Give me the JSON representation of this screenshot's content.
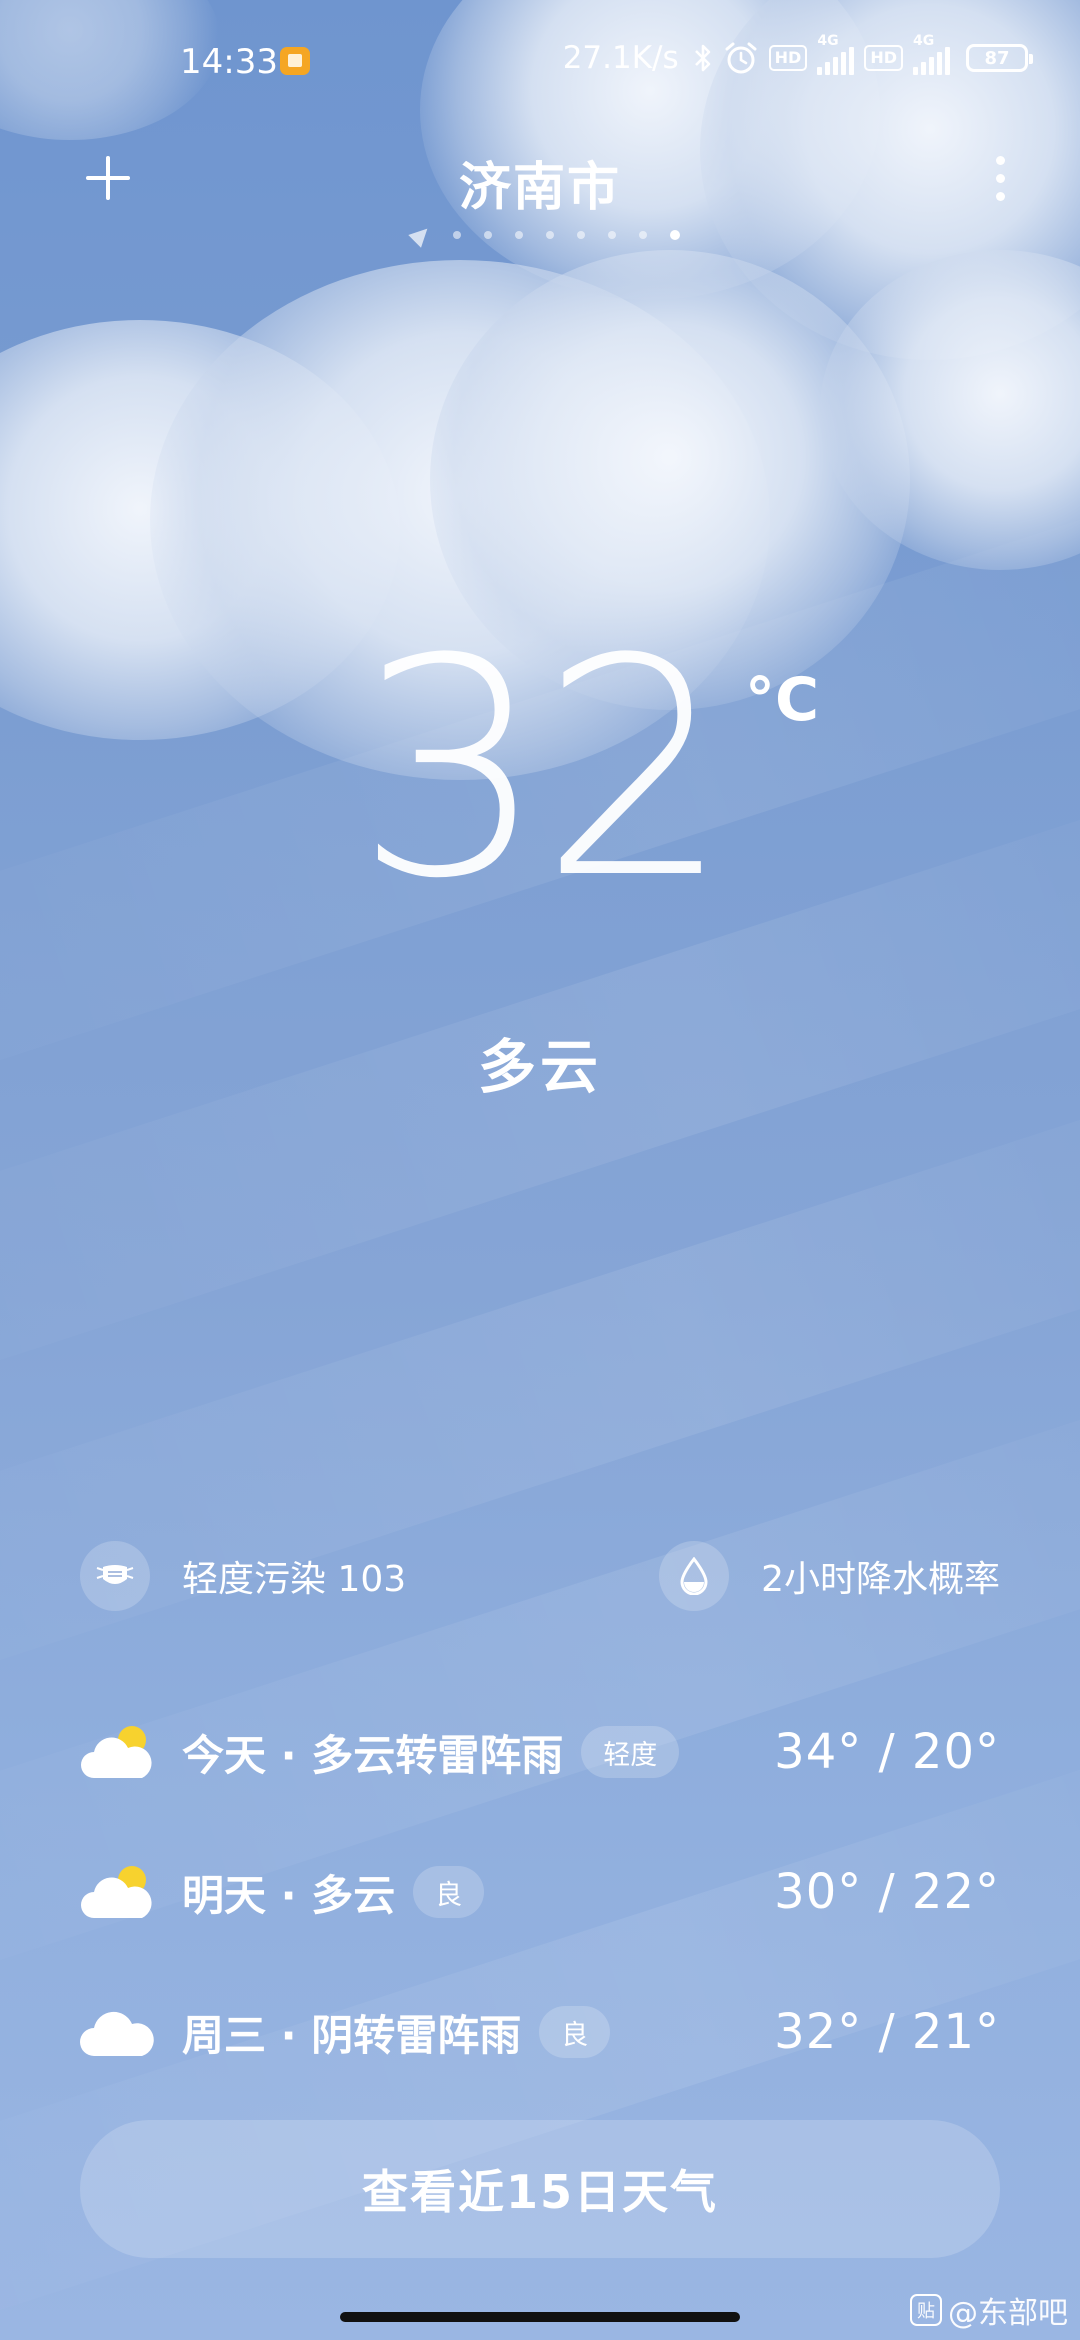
{
  "status_bar": {
    "time": "14:33",
    "net_speed": "27.1K/s",
    "hd_badge": "HD",
    "network_type": "4G",
    "battery": "87"
  },
  "header": {
    "city": "济南市"
  },
  "current": {
    "temperature": "32",
    "unit": "°C",
    "condition": "多云"
  },
  "info": {
    "aqi_label": "轻度污染 103",
    "rain_label": "2小时降水概率"
  },
  "forecast": [
    {
      "label": "今天 · 多云转雷阵雨",
      "aq": "轻度",
      "range": "34° / 20°",
      "icon": "partly-cloudy-icon"
    },
    {
      "label": "明天 · 多云",
      "aq": "良",
      "range": "30° / 22°",
      "icon": "partly-cloudy-icon"
    },
    {
      "label": "周三 · 阴转雷阵雨",
      "aq": "良",
      "range": "32° / 21°",
      "icon": "cloud-icon"
    }
  ],
  "button": {
    "label": "查看近15日天气"
  },
  "watermark": {
    "badge": "贴",
    "text": "@东部吧"
  },
  "colors": {
    "sky_top": "#6f95cf",
    "sky_bottom": "#9ab6e3",
    "sun": "#f7d22e"
  }
}
